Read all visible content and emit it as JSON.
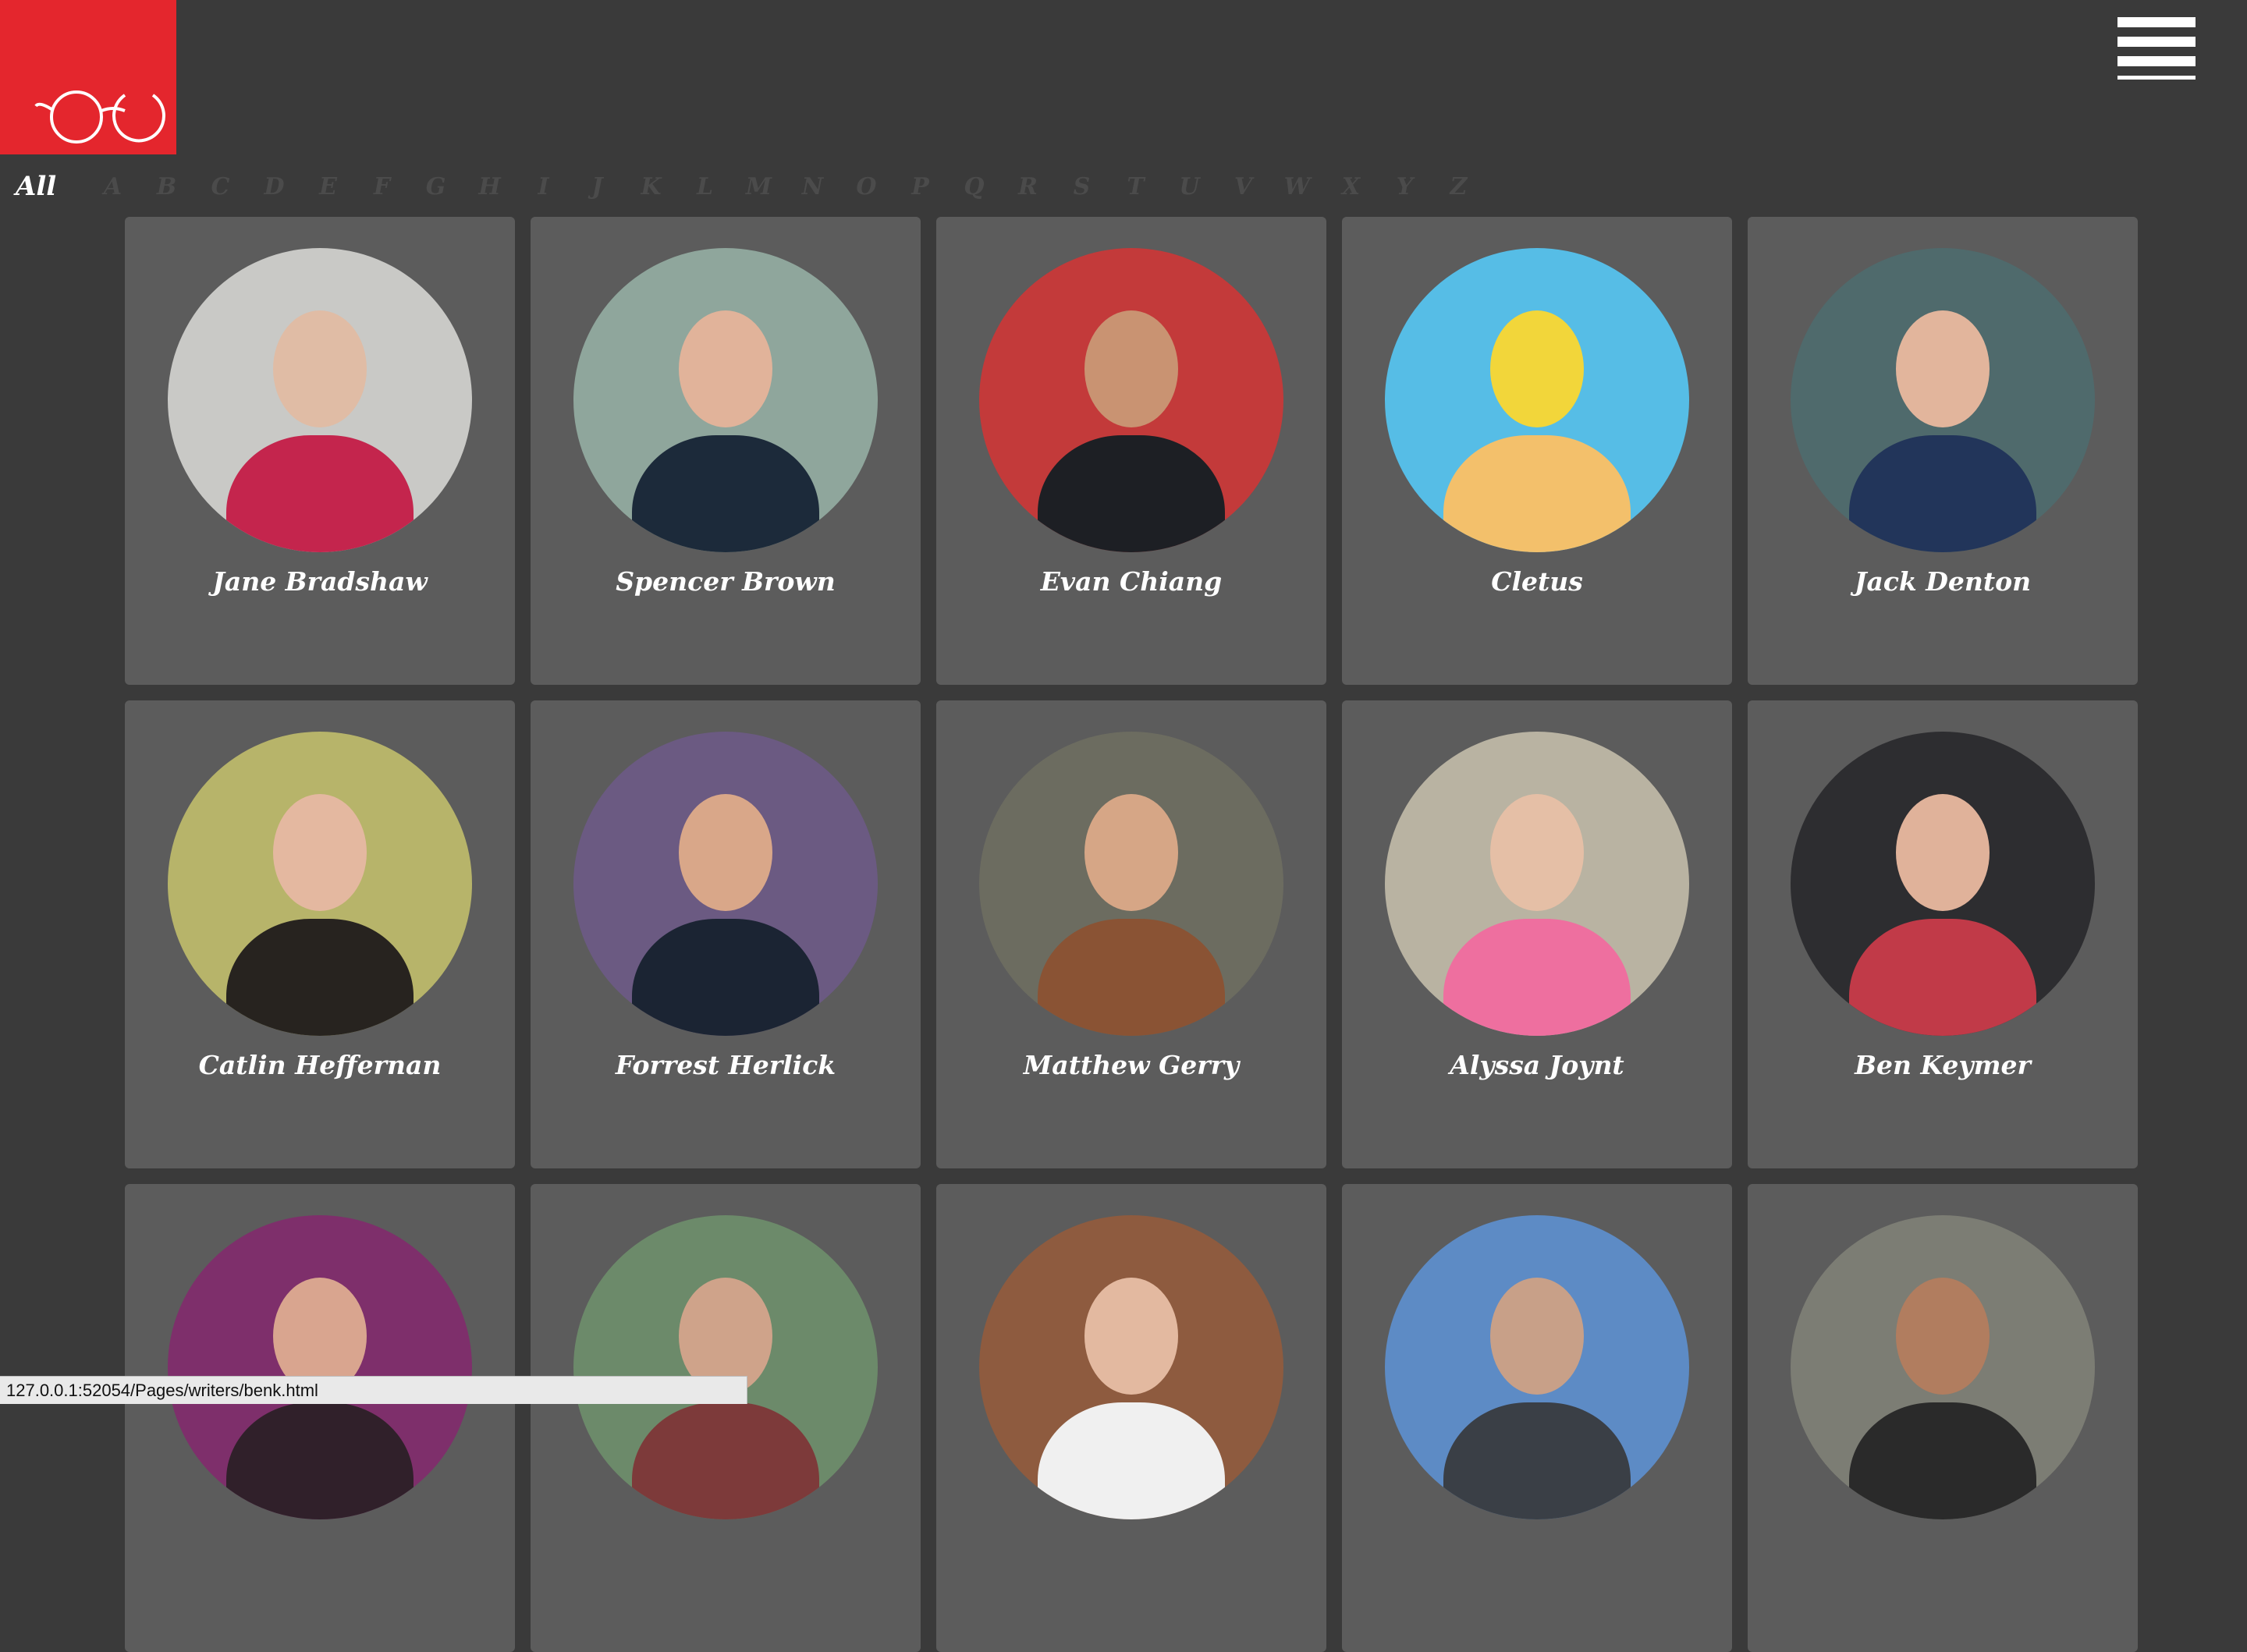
{
  "header": {
    "logo_icon": "glasses-icon",
    "menu_icon": "hamburger-menu-icon",
    "brand_color": "#e4262d"
  },
  "alphabet": {
    "all_label": "All",
    "letters": [
      "A",
      "B",
      "C",
      "D",
      "E",
      "F",
      "G",
      "H",
      "I",
      "J",
      "K",
      "L",
      "M",
      "N",
      "O",
      "P",
      "Q",
      "R",
      "S",
      "T",
      "U",
      "V",
      "W",
      "X",
      "Y",
      "Z"
    ]
  },
  "writers": [
    {
      "name": "Jane Bradshaw",
      "bg": "#c9c9c6",
      "skin": "#e0bca5",
      "cloth": "#c4254d"
    },
    {
      "name": "Spencer Brown",
      "bg": "#8fa69c",
      "skin": "#e1b39a",
      "cloth": "#1c2a3a"
    },
    {
      "name": "Evan Chiang",
      "bg": "#c33a3a",
      "skin": "#c99372",
      "cloth": "#1d1f24"
    },
    {
      "name": "Cletus",
      "bg": "#56bde6",
      "skin": "#f2d63a",
      "cloth": "#f3c06b"
    },
    {
      "name": "Jack Denton",
      "bg": "#4f6a6c",
      "skin": "#e2b59c",
      "cloth": "#22355a"
    },
    {
      "name": "Catlin Heffernan",
      "bg": "#b7b46a",
      "skin": "#e4b8a0",
      "cloth": "#27231f"
    },
    {
      "name": "Forrest Herlick",
      "bg": "#6b5a82",
      "skin": "#d9a789",
      "cloth": "#1b2433"
    },
    {
      "name": "Matthew Gerry",
      "bg": "#6c6c60",
      "skin": "#d6a686",
      "cloth": "#8a5334"
    },
    {
      "name": "Alyssa Joynt",
      "bg": "#b9b3a2",
      "skin": "#e5bfa6",
      "cloth": "#ee6f9f"
    },
    {
      "name": "Ben Keymer",
      "bg": "#2d2d30",
      "skin": "#e0b29a",
      "cloth": "#c13a48"
    },
    {
      "name": "",
      "bg": "#7e2f6b",
      "skin": "#d9a58f",
      "cloth": "#30202a"
    },
    {
      "name": "",
      "bg": "#6c8a6a",
      "skin": "#cfa38a",
      "cloth": "#7d3a3a"
    },
    {
      "name": "",
      "bg": "#8e5b3f",
      "skin": "#e3b9a0",
      "cloth": "#f0f0f0"
    },
    {
      "name": "",
      "bg": "#5d8bc5",
      "skin": "#c8a088",
      "cloth": "#3a3f46"
    },
    {
      "name": "",
      "bg": "#7c7d74",
      "skin": "#b17d5f",
      "cloth": "#2a2a2a"
    }
  ],
  "status_bar": {
    "url": "127.0.0.1:52054/Pages/writers/benk.html"
  }
}
